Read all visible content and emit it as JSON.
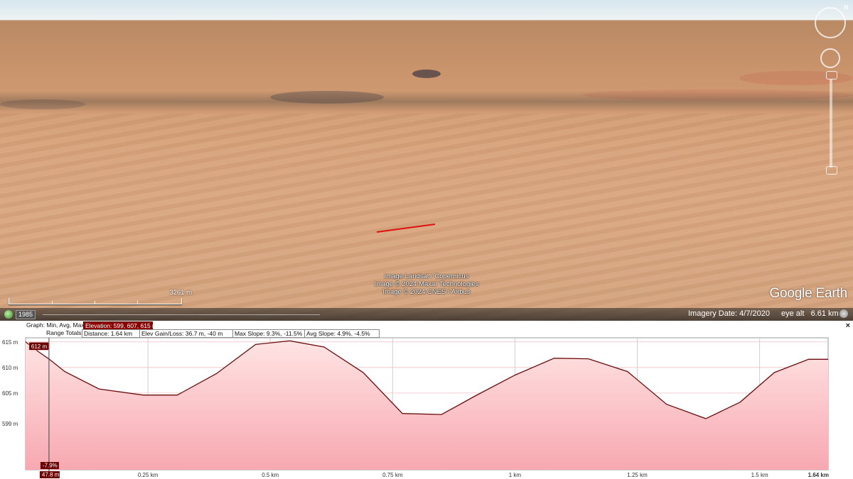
{
  "app": {
    "attribution": [
      "Image Landsat / Copernicus",
      "Image © 2024 Maxar Technologies",
      "Image © 2024 CNES / Airbus"
    ],
    "logo": "Google Earth",
    "scale_label": "3261 m",
    "north_label": "N"
  },
  "status_bar": {
    "year": "1985",
    "imagery_date": "Imagery Date: 4/7/2020",
    "eye_alt": "eye alt   6.61 km"
  },
  "profile": {
    "graph_label": "Graph: Min, Avg, Max",
    "elevation_stats": "Elevation: 599, 607, 615 m",
    "range_totals_label": "Range Totals:",
    "distance": "Distance: 1.64 km",
    "elev_gain_loss": "Elev Gain/Loss: 36.7 m, -40 m",
    "max_slope": "Max Slope: 9.3%, -11.5%",
    "avg_slope": "Avg Slope: 4.9%, -4.5%",
    "close": "×",
    "cursor_elevation": "612 m",
    "cursor_slope": "-7.9%",
    "cursor_distance": "47.8 m"
  },
  "chart_data": {
    "type": "area",
    "xlabel": "",
    "ylabel": "",
    "x_unit": "km",
    "y_unit": "m",
    "xlim": [
      0,
      1.64
    ],
    "ylim": [
      590,
      615.8
    ],
    "x_ticks": [
      {
        "value": 0.25,
        "label": "0.25 km"
      },
      {
        "value": 0.5,
        "label": "0.5 km"
      },
      {
        "value": 0.75,
        "label": "0.75 km"
      },
      {
        "value": 1.0,
        "label": "1 km"
      },
      {
        "value": 1.25,
        "label": "1.25 km"
      },
      {
        "value": 1.5,
        "label": "1.5 km"
      },
      {
        "value": 1.64,
        "label": "1.64 km"
      }
    ],
    "y_ticks": [
      {
        "value": 615,
        "label": "615 m"
      },
      {
        "value": 610,
        "label": "610 m"
      },
      {
        "value": 605,
        "label": "605 m"
      },
      {
        "value": 599,
        "label": "599 m"
      }
    ],
    "cursor": {
      "x": 0.0478,
      "y": 612
    },
    "series": [
      {
        "x": [
          0,
          0.02,
          0.05,
          0.08,
          0.15,
          0.24,
          0.31,
          0.39,
          0.47,
          0.54,
          0.61,
          0.69,
          0.77,
          0.85,
          0.92,
          1.0,
          1.08,
          1.15,
          1.23,
          1.31,
          1.39,
          1.46,
          1.53,
          1.6,
          1.64
        ],
        "y": [
          615,
          613.5,
          611.5,
          609.2,
          605.8,
          604.6,
          604.6,
          608.8,
          614.5,
          615.2,
          614,
          609,
          601,
          600.8,
          604.5,
          608.5,
          611.8,
          611.7,
          609.2,
          602.8,
          600,
          603.2,
          609,
          611.6,
          611.6
        ]
      }
    ]
  }
}
